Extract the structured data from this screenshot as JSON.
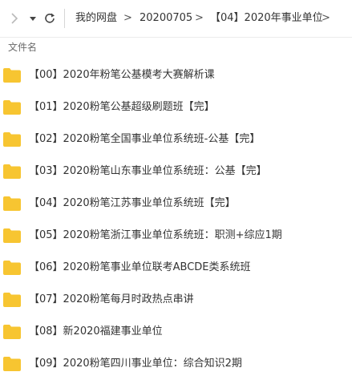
{
  "toolbar": {
    "forward_icon": "chevron-right-icon",
    "dropdown_icon": "caret-down-icon",
    "refresh_icon": "refresh-icon"
  },
  "breadcrumb": {
    "items": [
      "我的网盘",
      "20200705",
      "【04】2020年事业单位"
    ],
    "separator": ">"
  },
  "list": {
    "column_header": "文件名",
    "folder_color": "#f7c531",
    "files": [
      "【00】2020年粉笔公基模考大赛解析课",
      "【01】2020粉笔公基超级刷题班【完】",
      "【02】2020粉笔全国事业单位系统班-公基【完】",
      "【03】2020粉笔山东事业单位系统班：公基【完】",
      "【04】2020粉笔江苏事业单位系统班【完】",
      "【05】2020粉笔浙江事业单位系统班：职测+综应1期",
      "【06】2020粉笔事业单位联考ABCDE类系统班",
      "【07】2020粉笔每月时政热点串讲",
      "【08】新2020福建事业单位",
      "【09】2020粉笔四川事业单位：综合知识2期"
    ]
  }
}
